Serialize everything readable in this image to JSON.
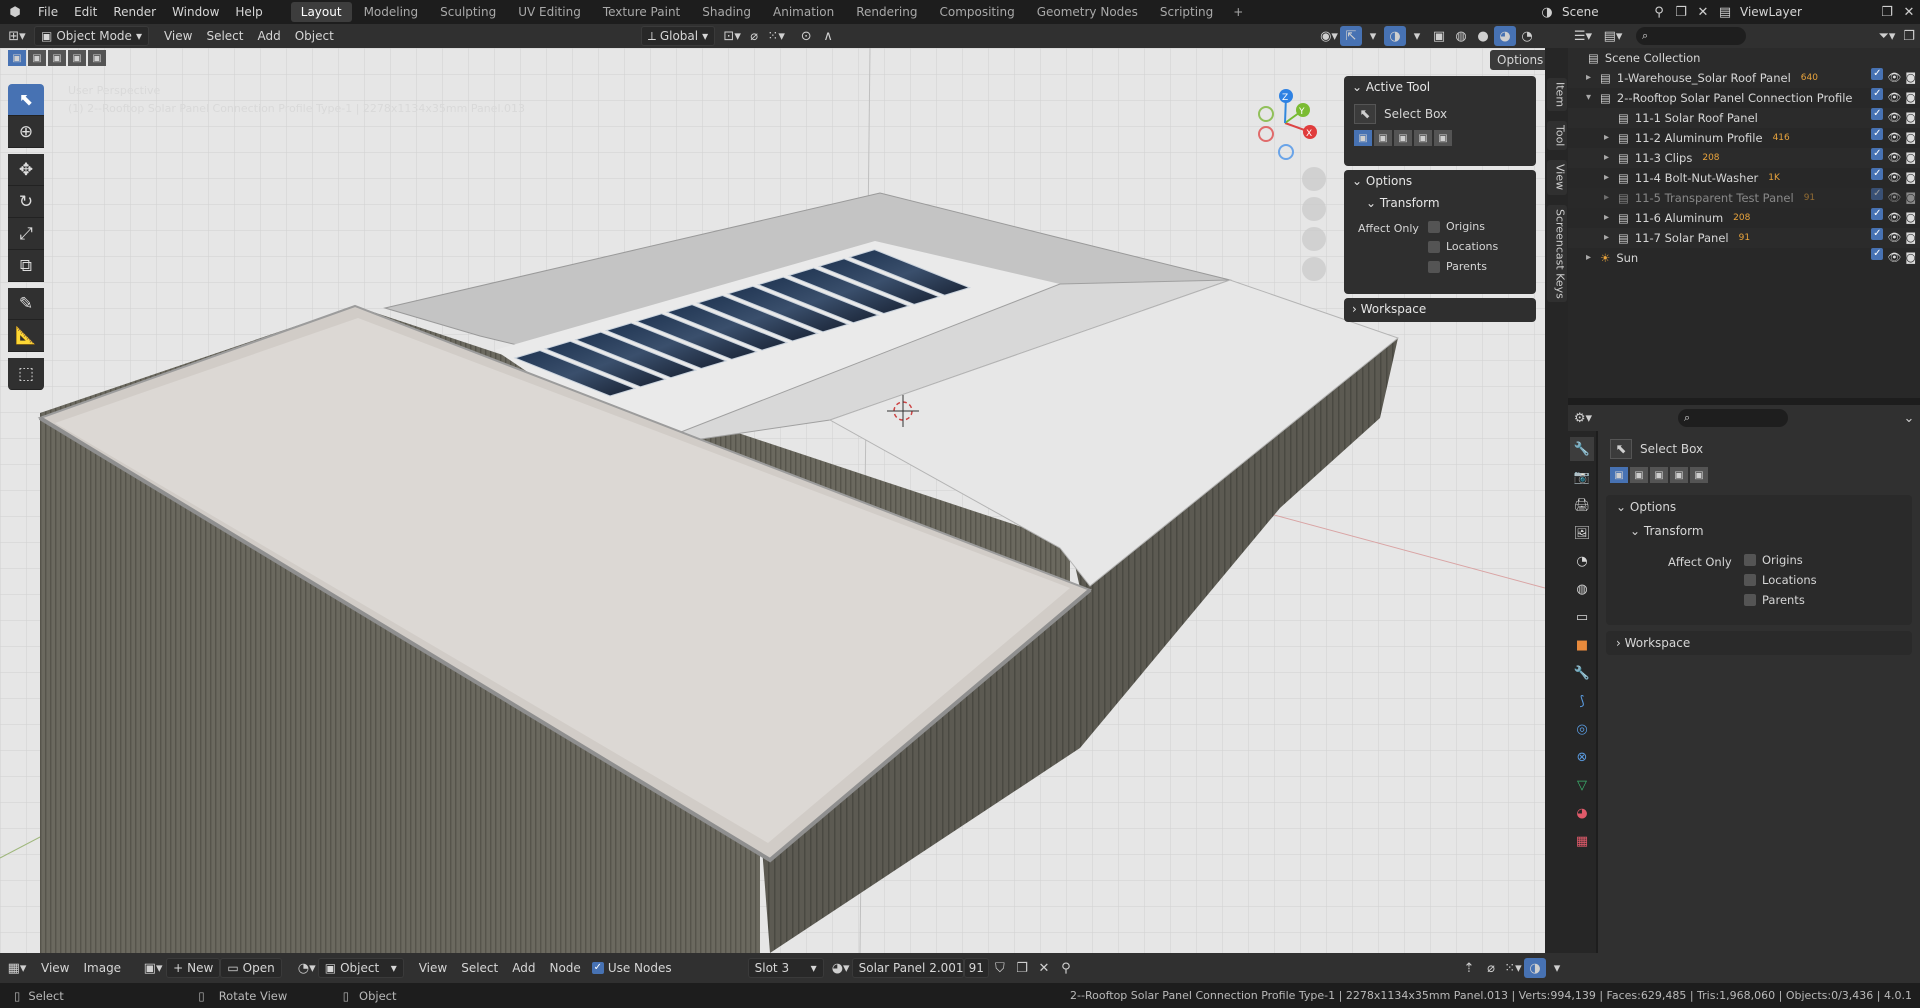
{
  "menu": {
    "items": [
      "File",
      "Edit",
      "Render",
      "Window",
      "Help"
    ],
    "workspaces": [
      "Layout",
      "Modeling",
      "Sculpting",
      "UV Editing",
      "Texture Paint",
      "Shading",
      "Animation",
      "Rendering",
      "Compositing",
      "Geometry Nodes",
      "Scripting"
    ],
    "active_workspace": "Layout",
    "scene": "Scene",
    "view_layer": "ViewLayer",
    "add_tab": "+"
  },
  "viewport_header": {
    "mode": "Object Mode",
    "menus": [
      "View",
      "Select",
      "Add",
      "Object"
    ],
    "transform_orientation": "Global",
    "options_label": "Options"
  },
  "viewport": {
    "perspective_label": "User Perspective",
    "object_info": "(1) 2--Rooftop Solar Panel Connection Profile Type-1 | 2278x1134x35mm Panel.013",
    "gizmo_axes": [
      "X",
      "Y",
      "Z"
    ],
    "side_tabs": [
      "Item",
      "Tool",
      "View",
      "Screencast Keys"
    ]
  },
  "npanel": {
    "active_tool_title": "Active Tool",
    "tool_name": "Select Box",
    "options_title": "Options",
    "transform_title": "Transform",
    "affect_only": "Affect Only",
    "checkboxes": [
      "Origins",
      "Locations",
      "Parents"
    ],
    "workspace_title": "Workspace"
  },
  "outliner": {
    "root": "Scene Collection",
    "rows": [
      {
        "name": "1-Warehouse_Solar Roof Panel",
        "badge": "640",
        "level": 1,
        "expanded": false
      },
      {
        "name": "2--Rooftop Solar Panel Connection Profile",
        "badge": "",
        "level": 1,
        "expanded": true
      },
      {
        "name": "11-1 Solar Roof Panel",
        "badge": "",
        "level": 2,
        "expanded": null
      },
      {
        "name": "11-2 Aluminum Profile",
        "badge": "416",
        "level": 2,
        "expanded": false
      },
      {
        "name": "11-3 Clips",
        "badge": "208",
        "level": 2,
        "expanded": false
      },
      {
        "name": "11-4 Bolt-Nut-Washer",
        "badge": "1K",
        "level": 2,
        "expanded": false
      },
      {
        "name": "11-5 Transparent Test Panel",
        "badge": "91",
        "level": 2,
        "expanded": false,
        "dimmed": true
      },
      {
        "name": "11-6 Aluminum",
        "badge": "208",
        "level": 2,
        "expanded": false
      },
      {
        "name": "11-7 Solar Panel",
        "badge": "91",
        "level": 2,
        "expanded": false
      },
      {
        "name": "Sun",
        "badge": "",
        "level": 1,
        "expanded": false,
        "light": true
      }
    ]
  },
  "properties": {
    "tool_name": "Select Box",
    "options_title": "Options",
    "transform_title": "Transform",
    "affect_only": "Affect Only",
    "checkboxes": [
      "Origins",
      "Locations",
      "Parents"
    ],
    "workspace_title": "Workspace"
  },
  "bottom_editor": {
    "menus_left": [
      "View",
      "Image"
    ],
    "new_label": "New",
    "open_label": "Open",
    "object_dd": "Object",
    "menus_mid": [
      "View",
      "Select",
      "Add",
      "Node"
    ],
    "use_nodes": "Use Nodes",
    "slot": "Slot 3",
    "material": "Solar Panel 2.001",
    "users": "91"
  },
  "statusbar": {
    "select": "Select",
    "rotate": "Rotate View",
    "object": "Object",
    "stats": "2--Rooftop Solar Panel Connection Profile Type-1 | 2278x1134x35mm Panel.013 | Verts:994,139 | Faces:629,485 | Tris:1,968,060 | Objects:0/3,436 | 4.0.1"
  },
  "colors": {
    "accent": "#4772b3",
    "roof": "#d6d3d0",
    "wall": "#6c6a60",
    "solar": "#1c2a3f"
  }
}
